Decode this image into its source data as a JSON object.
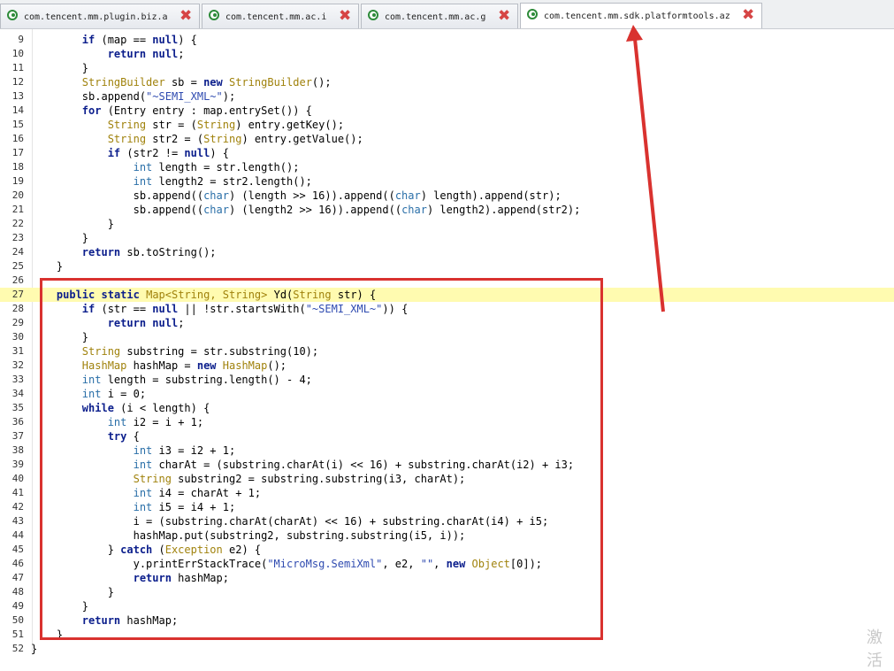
{
  "tabs": [
    {
      "label": "com.tencent.mm.plugin.biz.a",
      "active": false
    },
    {
      "label": "com.tencent.mm.ac.i",
      "active": false
    },
    {
      "label": "com.tencent.mm.ac.g",
      "active": false
    },
    {
      "label": "com.tencent.mm.sdk.platformtools.az",
      "active": true
    }
  ],
  "close_glyph": "✖",
  "code_lines": [
    {
      "n": "9",
      "tokens": [
        [
          "        ",
          ""
        ],
        [
          "if",
          "kw"
        ],
        [
          " (map == ",
          ""
        ],
        [
          "null",
          "kw"
        ],
        [
          ") {",
          ""
        ]
      ]
    },
    {
      "n": "10",
      "tokens": [
        [
          "            ",
          ""
        ],
        [
          "return",
          "kw"
        ],
        [
          " ",
          ""
        ],
        [
          "null",
          "kw"
        ],
        [
          ";",
          ""
        ]
      ]
    },
    {
      "n": "11",
      "tokens": [
        [
          "        }",
          ""
        ]
      ]
    },
    {
      "n": "12",
      "tokens": [
        [
          "        ",
          ""
        ],
        [
          "StringBuilder",
          "ty"
        ],
        [
          " sb = ",
          ""
        ],
        [
          "new",
          "kw"
        ],
        [
          " ",
          ""
        ],
        [
          "StringBuilder",
          "ty"
        ],
        [
          "();",
          ""
        ]
      ]
    },
    {
      "n": "13",
      "tokens": [
        [
          "        sb.append(",
          ""
        ],
        [
          "\"~SEMI_XML~\"",
          "str"
        ],
        [
          ");",
          ""
        ]
      ]
    },
    {
      "n": "14",
      "tokens": [
        [
          "        ",
          ""
        ],
        [
          "for",
          "kw"
        ],
        [
          " (Entry entry : map.entrySet()) {",
          ""
        ]
      ]
    },
    {
      "n": "15",
      "tokens": [
        [
          "            ",
          ""
        ],
        [
          "String",
          "ty"
        ],
        [
          " str = (",
          ""
        ],
        [
          "String",
          "ty"
        ],
        [
          ") entry.getKey();",
          ""
        ]
      ]
    },
    {
      "n": "16",
      "tokens": [
        [
          "            ",
          ""
        ],
        [
          "String",
          "ty"
        ],
        [
          " str2 = (",
          ""
        ],
        [
          "String",
          "ty"
        ],
        [
          ") entry.getValue();",
          ""
        ]
      ]
    },
    {
      "n": "17",
      "tokens": [
        [
          "            ",
          ""
        ],
        [
          "if",
          "kw"
        ],
        [
          " (str2 != ",
          ""
        ],
        [
          "null",
          "kw"
        ],
        [
          ") {",
          ""
        ]
      ]
    },
    {
      "n": "18",
      "tokens": [
        [
          "                ",
          ""
        ],
        [
          "int",
          "pt"
        ],
        [
          " length = str.length();",
          ""
        ]
      ]
    },
    {
      "n": "19",
      "tokens": [
        [
          "                ",
          ""
        ],
        [
          "int",
          "pt"
        ],
        [
          " length2 = str2.length();",
          ""
        ]
      ]
    },
    {
      "n": "20",
      "tokens": [
        [
          "                sb.append((",
          ""
        ],
        [
          "char",
          "pt"
        ],
        [
          ") (length >> 16)).append((",
          ""
        ],
        [
          "char",
          "pt"
        ],
        [
          ") length).append(str);",
          ""
        ]
      ]
    },
    {
      "n": "21",
      "tokens": [
        [
          "                sb.append((",
          ""
        ],
        [
          "char",
          "pt"
        ],
        [
          ") (length2 >> 16)).append((",
          ""
        ],
        [
          "char",
          "pt"
        ],
        [
          ") length2).append(str2);",
          ""
        ]
      ]
    },
    {
      "n": "22",
      "tokens": [
        [
          "            }",
          ""
        ]
      ]
    },
    {
      "n": "23",
      "tokens": [
        [
          "        }",
          ""
        ]
      ]
    },
    {
      "n": "24",
      "tokens": [
        [
          "        ",
          ""
        ],
        [
          "return",
          "kw"
        ],
        [
          " sb.toString();",
          ""
        ]
      ]
    },
    {
      "n": "25",
      "tokens": [
        [
          "    }",
          ""
        ]
      ]
    },
    {
      "n": "26",
      "tokens": [
        [
          "",
          ""
        ]
      ]
    },
    {
      "n": "27",
      "hl": true,
      "tokens": [
        [
          "    ",
          ""
        ],
        [
          "public",
          "kw"
        ],
        [
          " ",
          ""
        ],
        [
          "static",
          "kw"
        ],
        [
          " ",
          ""
        ],
        [
          "Map<String, String>",
          "ty"
        ],
        [
          " Yd(",
          ""
        ],
        [
          "String",
          "ty"
        ],
        [
          " str) {",
          ""
        ]
      ]
    },
    {
      "n": "28",
      "tokens": [
        [
          "        ",
          ""
        ],
        [
          "if",
          "kw"
        ],
        [
          " (str == ",
          ""
        ],
        [
          "null",
          "kw"
        ],
        [
          " || !str.startsWith(",
          ""
        ],
        [
          "\"~SEMI_XML~\"",
          "str"
        ],
        [
          ")) {",
          ""
        ]
      ]
    },
    {
      "n": "29",
      "tokens": [
        [
          "            ",
          ""
        ],
        [
          "return",
          "kw"
        ],
        [
          " ",
          ""
        ],
        [
          "null",
          "kw"
        ],
        [
          ";",
          ""
        ]
      ]
    },
    {
      "n": "30",
      "tokens": [
        [
          "        }",
          ""
        ]
      ]
    },
    {
      "n": "31",
      "tokens": [
        [
          "        ",
          ""
        ],
        [
          "String",
          "ty"
        ],
        [
          " substring = str.substring(10);",
          ""
        ]
      ]
    },
    {
      "n": "32",
      "tokens": [
        [
          "        ",
          ""
        ],
        [
          "HashMap",
          "ty"
        ],
        [
          " hashMap = ",
          ""
        ],
        [
          "new",
          "kw"
        ],
        [
          " ",
          ""
        ],
        [
          "HashMap",
          "ty"
        ],
        [
          "();",
          ""
        ]
      ]
    },
    {
      "n": "33",
      "tokens": [
        [
          "        ",
          ""
        ],
        [
          "int",
          "pt"
        ],
        [
          " length = substring.length() - 4;",
          ""
        ]
      ]
    },
    {
      "n": "34",
      "tokens": [
        [
          "        ",
          ""
        ],
        [
          "int",
          "pt"
        ],
        [
          " i = 0;",
          ""
        ]
      ]
    },
    {
      "n": "35",
      "tokens": [
        [
          "        ",
          ""
        ],
        [
          "while",
          "kw"
        ],
        [
          " (i < length) {",
          ""
        ]
      ]
    },
    {
      "n": "36",
      "tokens": [
        [
          "            ",
          ""
        ],
        [
          "int",
          "pt"
        ],
        [
          " i2 = i + 1;",
          ""
        ]
      ]
    },
    {
      "n": "37",
      "tokens": [
        [
          "            ",
          ""
        ],
        [
          "try",
          "kw"
        ],
        [
          " {",
          ""
        ]
      ]
    },
    {
      "n": "38",
      "tokens": [
        [
          "                ",
          ""
        ],
        [
          "int",
          "pt"
        ],
        [
          " i3 = i2 + 1;",
          ""
        ]
      ]
    },
    {
      "n": "39",
      "tokens": [
        [
          "                ",
          ""
        ],
        [
          "int",
          "pt"
        ],
        [
          " charAt = (substring.charAt(i) << 16) + substring.charAt(i2) + i3;",
          ""
        ]
      ]
    },
    {
      "n": "40",
      "tokens": [
        [
          "                ",
          ""
        ],
        [
          "String",
          "ty"
        ],
        [
          " substring2 = substring.substring(i3, charAt);",
          ""
        ]
      ]
    },
    {
      "n": "41",
      "tokens": [
        [
          "                ",
          ""
        ],
        [
          "int",
          "pt"
        ],
        [
          " i4 = charAt + 1;",
          ""
        ]
      ]
    },
    {
      "n": "42",
      "tokens": [
        [
          "                ",
          ""
        ],
        [
          "int",
          "pt"
        ],
        [
          " i5 = i4 + 1;",
          ""
        ]
      ]
    },
    {
      "n": "43",
      "tokens": [
        [
          "                i = (substring.charAt(charAt) << 16) + substring.charAt(i4) + i5;",
          ""
        ]
      ]
    },
    {
      "n": "44",
      "tokens": [
        [
          "                hashMap.put(substring2, substring.substring(i5, i));",
          ""
        ]
      ]
    },
    {
      "n": "45",
      "tokens": [
        [
          "            } ",
          ""
        ],
        [
          "catch",
          "kw"
        ],
        [
          " (",
          ""
        ],
        [
          "Exception",
          "ty"
        ],
        [
          " e2) {",
          ""
        ]
      ]
    },
    {
      "n": "46",
      "tokens": [
        [
          "                y.printErrStackTrace(",
          ""
        ],
        [
          "\"MicroMsg.SemiXml\"",
          "str"
        ],
        [
          ", e2, ",
          ""
        ],
        [
          "\"\"",
          "str"
        ],
        [
          ", ",
          ""
        ],
        [
          "new",
          "kw"
        ],
        [
          " ",
          ""
        ],
        [
          "Object",
          "ty"
        ],
        [
          "[0]);",
          ""
        ]
      ]
    },
    {
      "n": "47",
      "tokens": [
        [
          "                ",
          ""
        ],
        [
          "return",
          "kw"
        ],
        [
          " hashMap;",
          ""
        ]
      ]
    },
    {
      "n": "48",
      "tokens": [
        [
          "            }",
          ""
        ]
      ]
    },
    {
      "n": "49",
      "tokens": [
        [
          "        }",
          ""
        ]
      ]
    },
    {
      "n": "50",
      "tokens": [
        [
          "        ",
          ""
        ],
        [
          "return",
          "kw"
        ],
        [
          " hashMap;",
          ""
        ]
      ]
    },
    {
      "n": "51",
      "tokens": [
        [
          "    }",
          ""
        ]
      ]
    },
    {
      "n": "52",
      "tokens": [
        [
          "}",
          ""
        ]
      ]
    }
  ],
  "annotation_color": "#d9322f",
  "watermark": "激活"
}
